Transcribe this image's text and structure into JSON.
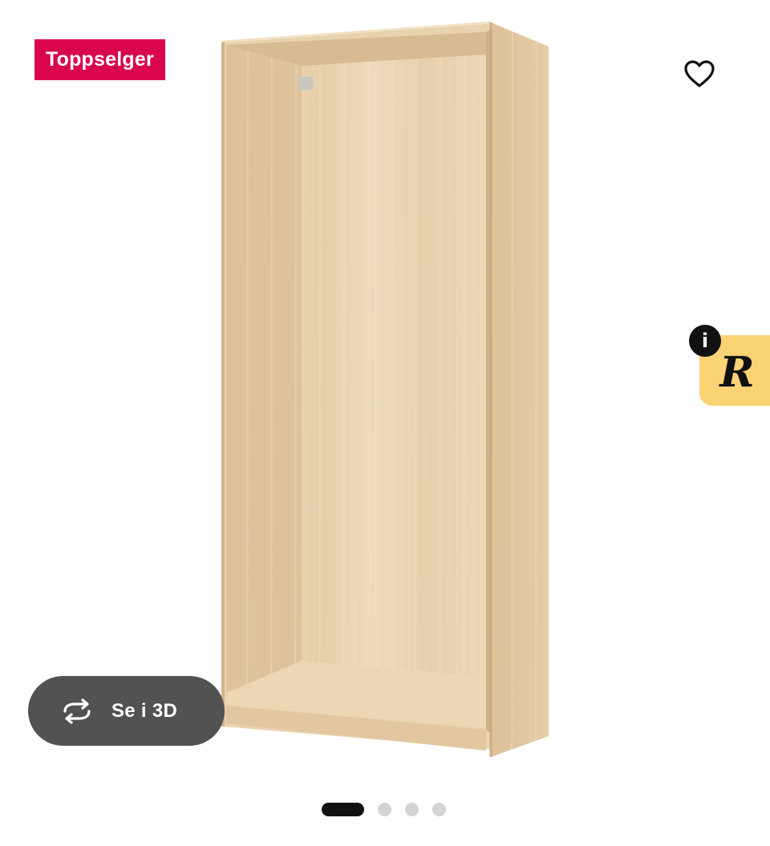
{
  "badge": {
    "label": "Toppselger",
    "color": "#d9054f"
  },
  "favorite": {
    "icon": "heart-outline-icon"
  },
  "plugin": {
    "letter": "R",
    "info_symbol": "i",
    "color": "#fbd274"
  },
  "view_3d": {
    "label": "Se i 3D",
    "icon": "rotate-3d-icon"
  },
  "pagination": {
    "total": 4,
    "active_index": 0
  },
  "product_image": {
    "subject": "wardrobe-frame"
  }
}
